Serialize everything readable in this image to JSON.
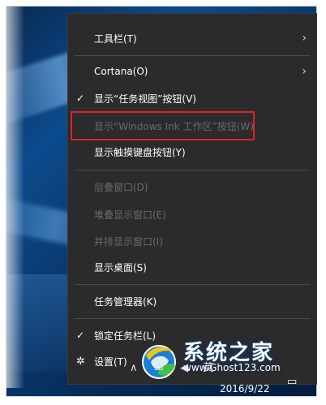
{
  "context_menu": {
    "items": [
      {
        "label": "工具栏(T)",
        "checked": false,
        "disabled": false,
        "submenu": true
      },
      {
        "label": "Cortana(O)",
        "checked": false,
        "disabled": false,
        "submenu": true
      },
      {
        "label": "显示“任务视图”按钮(V)",
        "checked": true,
        "disabled": false,
        "submenu": false
      },
      {
        "label": "显示“Windows Ink 工作区”按钮(W)",
        "checked": false,
        "disabled": true,
        "submenu": false,
        "highlighted": true
      },
      {
        "label": "显示触摸键盘按钮(Y)",
        "checked": false,
        "disabled": false,
        "submenu": false
      },
      {
        "label": "层叠窗口(D)",
        "checked": false,
        "disabled": true,
        "submenu": false
      },
      {
        "label": "堆叠显示窗口(E)",
        "checked": false,
        "disabled": true,
        "submenu": false
      },
      {
        "label": "并排显示窗口(I)",
        "checked": false,
        "disabled": true,
        "submenu": false
      },
      {
        "label": "显示桌面(S)",
        "checked": false,
        "disabled": false,
        "submenu": false
      },
      {
        "label": "任务管理器(K)",
        "checked": false,
        "disabled": false,
        "submenu": false
      },
      {
        "label": "锁定任务栏(L)",
        "checked": true,
        "disabled": false,
        "submenu": false
      },
      {
        "label": "设置(T)",
        "checked": false,
        "disabled": false,
        "submenu": false,
        "icon": "gear-icon"
      }
    ],
    "check_glyph": "✓",
    "arrow_glyph": "›",
    "highlight_color": "#e0222a"
  },
  "taskbar": {
    "date": "2016/9/22",
    "tray_text": "英"
  },
  "watermark": {
    "title": "系统之家",
    "url": "www.Ghost123.com"
  }
}
